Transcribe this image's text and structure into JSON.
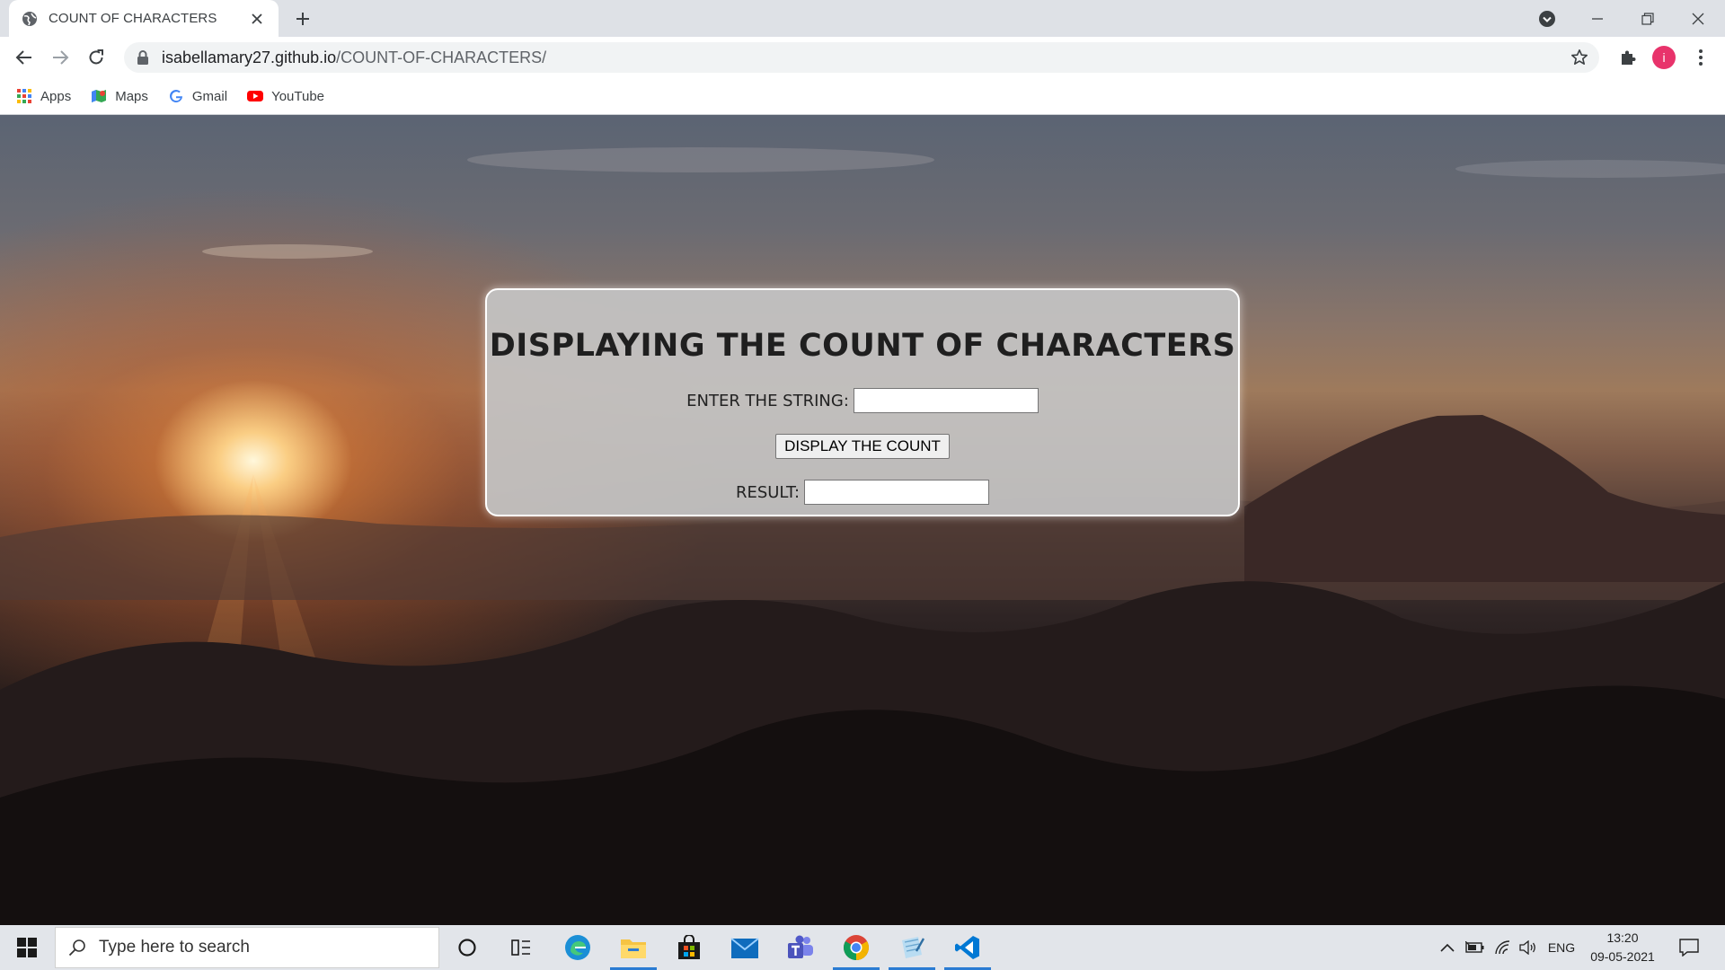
{
  "browser": {
    "tab": {
      "title": "COUNT OF CHARACTERS"
    },
    "url": {
      "host": "isabellamary27.github.io",
      "path": "/COUNT-OF-CHARACTERS/"
    },
    "bookmarks": [
      {
        "label": "Apps"
      },
      {
        "label": "Maps"
      },
      {
        "label": "Gmail"
      },
      {
        "label": "YouTube"
      }
    ],
    "profile_initial": "i"
  },
  "page": {
    "title": "DISPLAYING THE COUNT OF CHARACTERS",
    "string_label": "ENTER THE STRING:",
    "string_value": "",
    "button_label": "DISPLAY THE COUNT",
    "result_label": "RESULT:",
    "result_value": ""
  },
  "taskbar": {
    "search_placeholder": "Type here to search",
    "language": "ENG",
    "time": "13:20",
    "date": "09-05-2021"
  },
  "colors": {
    "avatar": "#e8336b",
    "active_indicator": "#2b7cd3"
  }
}
